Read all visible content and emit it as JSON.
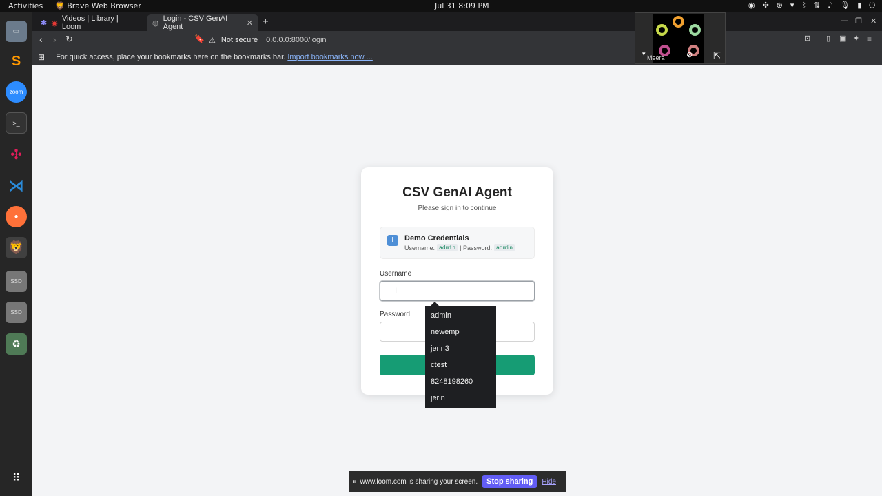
{
  "topbar": {
    "activities": "Activities",
    "app_name": "Brave Web Browser",
    "clock": "Jul 31  8:09 PM"
  },
  "dock": {
    "items": [
      "files-icon",
      "sublime-text-icon",
      "zoom-icon",
      "terminal-icon",
      "slack-icon",
      "vscode-icon",
      "firefox-icon",
      "brave-icon",
      "ssd-drive-icon",
      "ssd-drive-icon",
      "trash-icon",
      "show-apps-icon"
    ],
    "zoom_label": "zoom",
    "ssd_label": "SSD"
  },
  "browser": {
    "tabs": [
      {
        "label": "Videos | Library | Loom"
      },
      {
        "label": "Login - CSV GenAI Agent"
      }
    ],
    "omnibox": {
      "security": "Not secure",
      "url": "0.0.0.0:8000/login"
    },
    "bookmarks_bar": {
      "message": "For quick access, place your bookmarks here on the bookmarks bar.",
      "link": "Import bookmarks now ..."
    }
  },
  "loom_camera": {
    "name": "Meera"
  },
  "login": {
    "title": "CSV GenAI Agent",
    "subtitle": "Please sign in to continue",
    "demo": {
      "heading": "Demo Credentials",
      "username_label": "Username:",
      "username_value": "admin",
      "separator": "| Password:",
      "password_value": "admin"
    },
    "username_label": "Username",
    "username_value": "",
    "password_label": "Password",
    "signin_label": ""
  },
  "autocomplete": {
    "options": [
      "admin",
      "newemp",
      "jerin3",
      "ctest",
      "8248198260",
      "jerin"
    ]
  },
  "share_banner": {
    "message": "www.loom.com is sharing your screen.",
    "stop": "Stop sharing",
    "hide": "Hide"
  },
  "colors": {
    "primary_button": "#169c74",
    "stop_sharing": "#625df5",
    "page_bg": "#f3f4f6"
  }
}
